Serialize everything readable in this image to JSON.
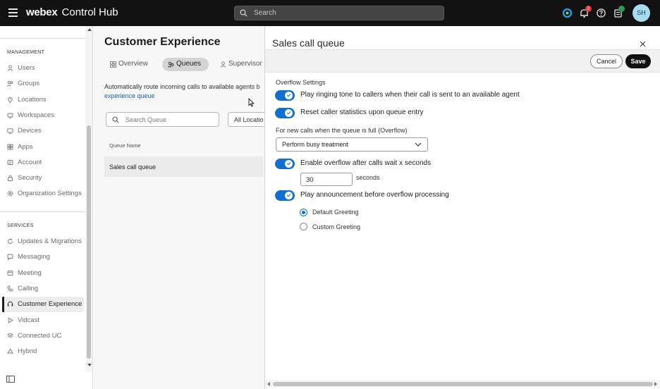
{
  "topbar": {
    "brand_bold": "webex",
    "brand_rest": "Control Hub",
    "search_placeholder": "Search",
    "notifications_count": "2",
    "avatar_initials": "SH"
  },
  "sidebar": {
    "management_header": "MANAGEMENT",
    "management_items": [
      {
        "label": "Users",
        "icon": "user-icon"
      },
      {
        "label": "Groups",
        "icon": "groups-icon"
      },
      {
        "label": "Locations",
        "icon": "location-pin-icon"
      },
      {
        "label": "Workspaces",
        "icon": "workspace-icon"
      },
      {
        "label": "Devices",
        "icon": "device-icon"
      },
      {
        "label": "Apps",
        "icon": "apps-grid-icon"
      },
      {
        "label": "Account",
        "icon": "account-icon"
      },
      {
        "label": "Security",
        "icon": "lock-icon"
      },
      {
        "label": "Organization Settings",
        "icon": "gear-icon"
      }
    ],
    "services_header": "SERVICES",
    "services_items": [
      {
        "label": "Updates & Migrations",
        "icon": "refresh-icon"
      },
      {
        "label": "Messaging",
        "icon": "chat-bubble-icon"
      },
      {
        "label": "Meeting",
        "icon": "meeting-icon"
      },
      {
        "label": "Calling",
        "icon": "phone-icon"
      },
      {
        "label": "Customer Experience",
        "icon": "headset-icon",
        "active": true
      },
      {
        "label": "Vidcast",
        "icon": "play-icon"
      },
      {
        "label": "Connected UC",
        "icon": "connected-uc-icon"
      },
      {
        "label": "Hybrid",
        "icon": "cloud-icon"
      }
    ]
  },
  "main": {
    "title": "Customer Experience",
    "tabs": [
      {
        "label": "Overview",
        "icon": "grid-icon",
        "active": false
      },
      {
        "label": "Queues",
        "icon": "queue-icon",
        "active": true
      },
      {
        "label": "Supervisor",
        "icon": "supervisor-icon",
        "active": false
      }
    ],
    "description_line1": "Automatically route incoming calls to available agents b",
    "description_link": "experience queue",
    "search_placeholder": "Search Queue",
    "location_filter": "All Locatio",
    "table": {
      "column_header": "Queue Name",
      "rows": [
        {
          "name": "Sales call queue"
        }
      ]
    }
  },
  "panel": {
    "title": "Sales call queue",
    "cancel_label": "Cancel",
    "save_label": "Save",
    "section_label": "Overflow Settings",
    "toggles": [
      {
        "label": "Play ringing tone to callers when their call is sent to an available agent",
        "on": true
      },
      {
        "label": "Reset caller statistics upon queue entry",
        "on": true
      }
    ],
    "overflow_label": "For new calls when the queue is full (Overflow)",
    "overflow_selected": "Perform busy treatment",
    "enable_overflow_label": "Enable overflow after calls wait x seconds",
    "enable_overflow_on": true,
    "wait_seconds_value": "30",
    "wait_seconds_unit": "seconds",
    "announcement_label": "Play announcement before overflow processing",
    "announcement_on": true,
    "greeting_options": [
      {
        "label": "Default Greeting",
        "selected": true
      },
      {
        "label": "Custom Greeting",
        "selected": false
      }
    ]
  },
  "colors": {
    "accent_blue": "#1170cf",
    "topbar_bg": "#121212",
    "save_button_bg": "#111111",
    "badge_red": "#e23838"
  }
}
